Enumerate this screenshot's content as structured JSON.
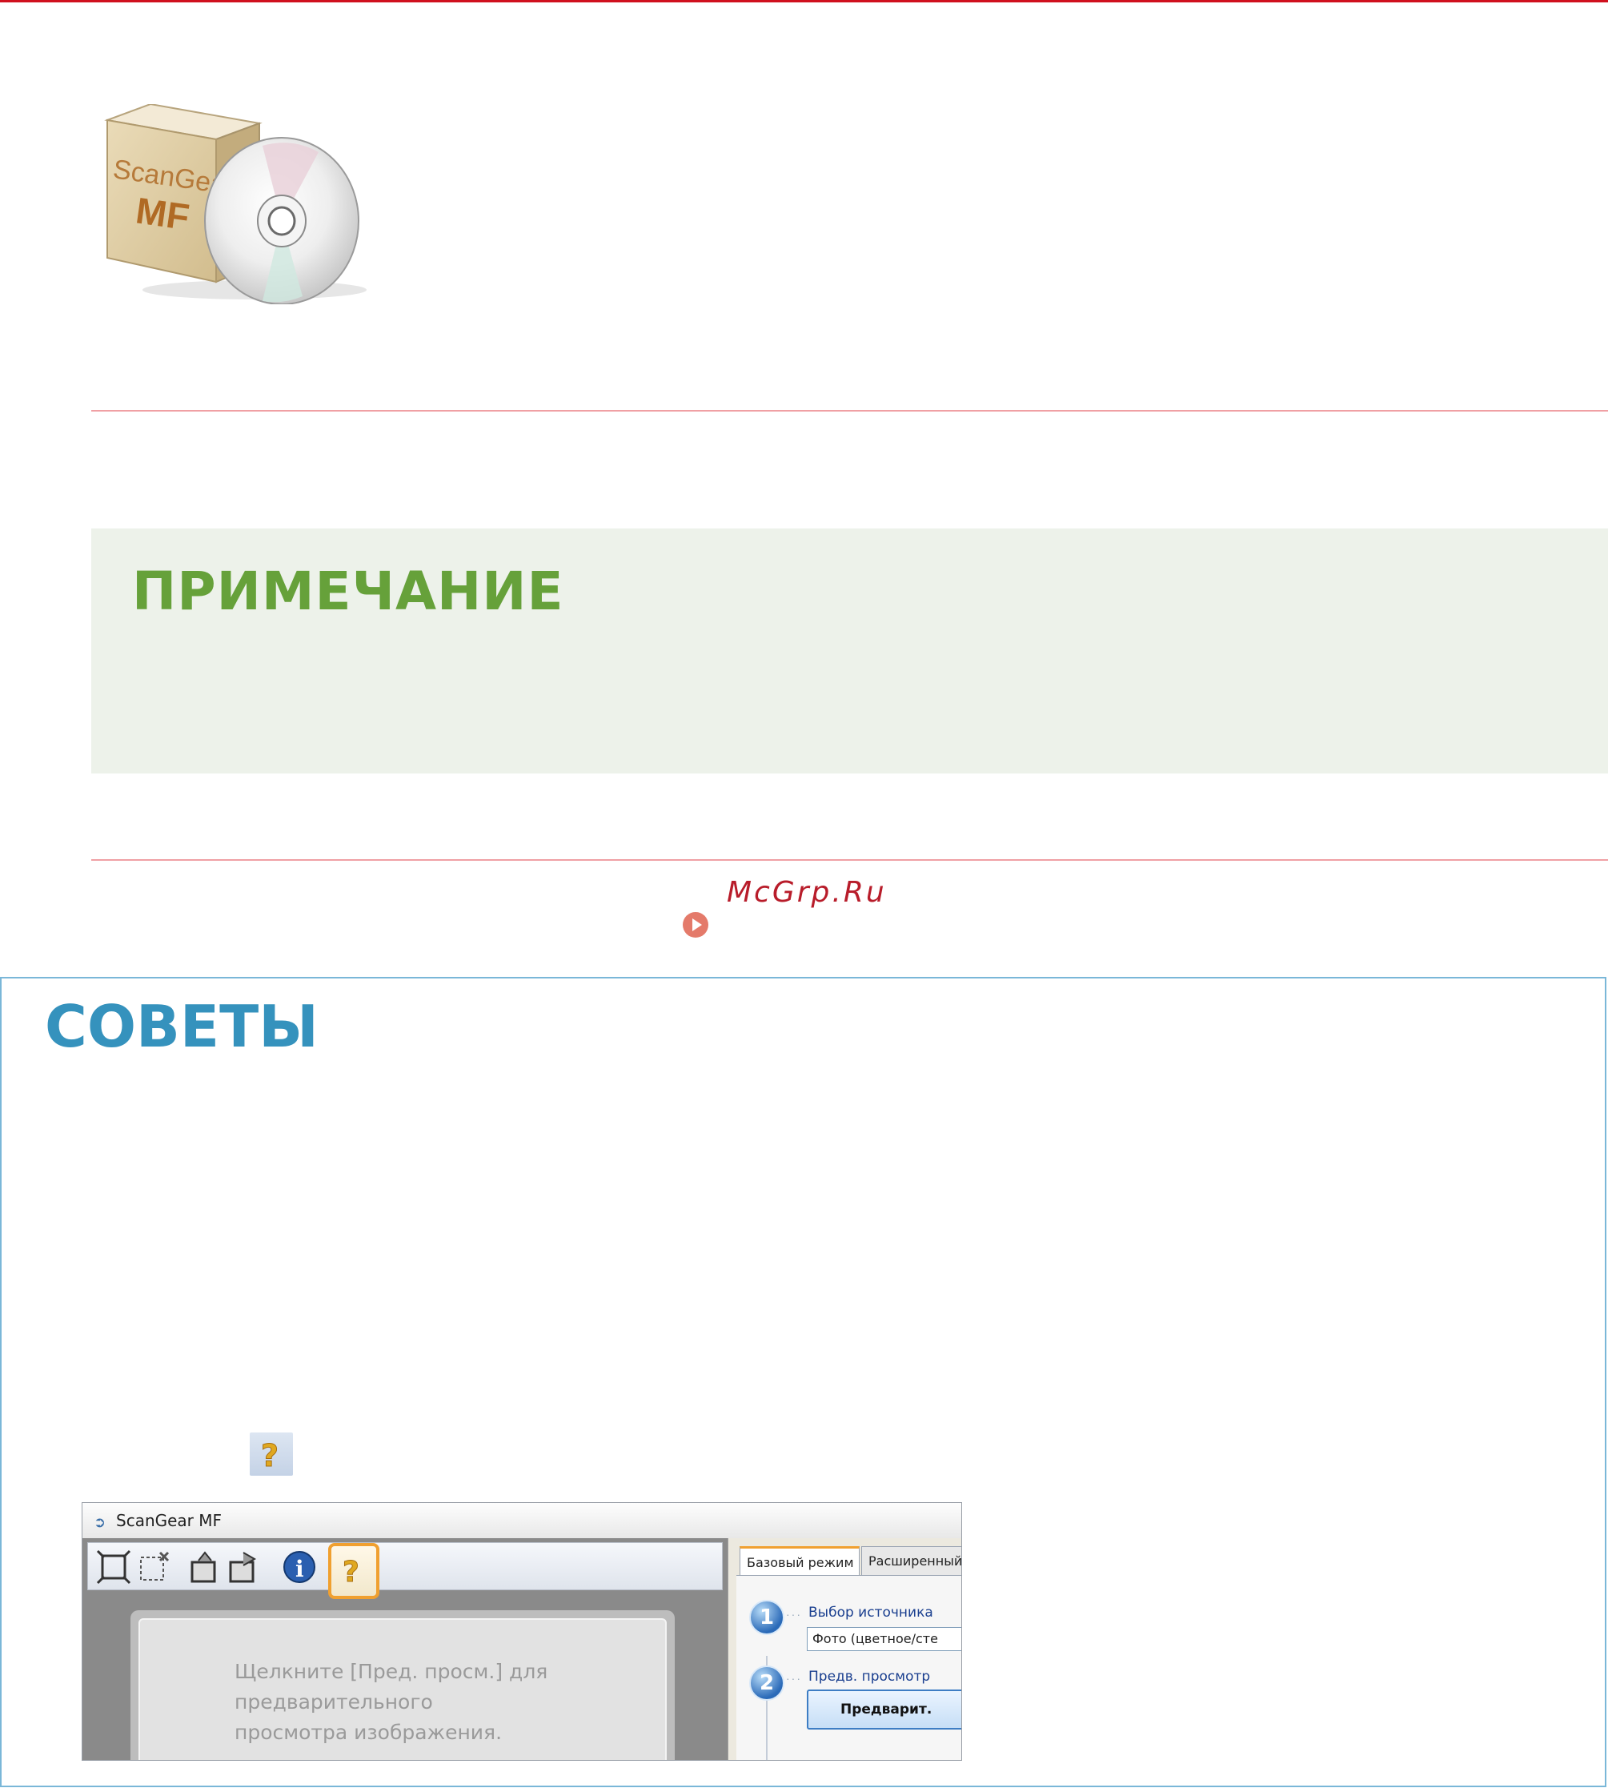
{
  "product": {
    "box_line1": "ScanGear",
    "box_line2": "MF"
  },
  "note": {
    "title": "ПРИМЕЧАНИЕ"
  },
  "watermark": "McGrp.Ru",
  "tips": {
    "title": "СОВЕТЫ"
  },
  "scangear_window": {
    "title": "ScanGear MF",
    "preview_text": "Щелкните [Пред. просм.] для\nпредварительного\nпросмотра изображения.",
    "tabs": [
      {
        "label": "Базовый режим"
      },
      {
        "label": "Расширенный р"
      }
    ],
    "steps": [
      {
        "number": "1",
        "label": "Выбор источника",
        "select_value": "Фото (цветное/сте"
      },
      {
        "number": "2",
        "label": "Предв. просмотр",
        "button_label": "Предварит."
      }
    ]
  },
  "colors": {
    "accent_red": "#d0101e",
    "note_green": "#66a13a",
    "tips_blue": "#3592bd",
    "help_highlight": "#f0a030"
  },
  "icons": [
    "product-box-icon",
    "cd-disc-icon",
    "link-arrow-icon",
    "help-question-icon",
    "fit-page-icon",
    "deselect-icon",
    "rotate-left-icon",
    "rotate-right-icon",
    "info-icon"
  ]
}
